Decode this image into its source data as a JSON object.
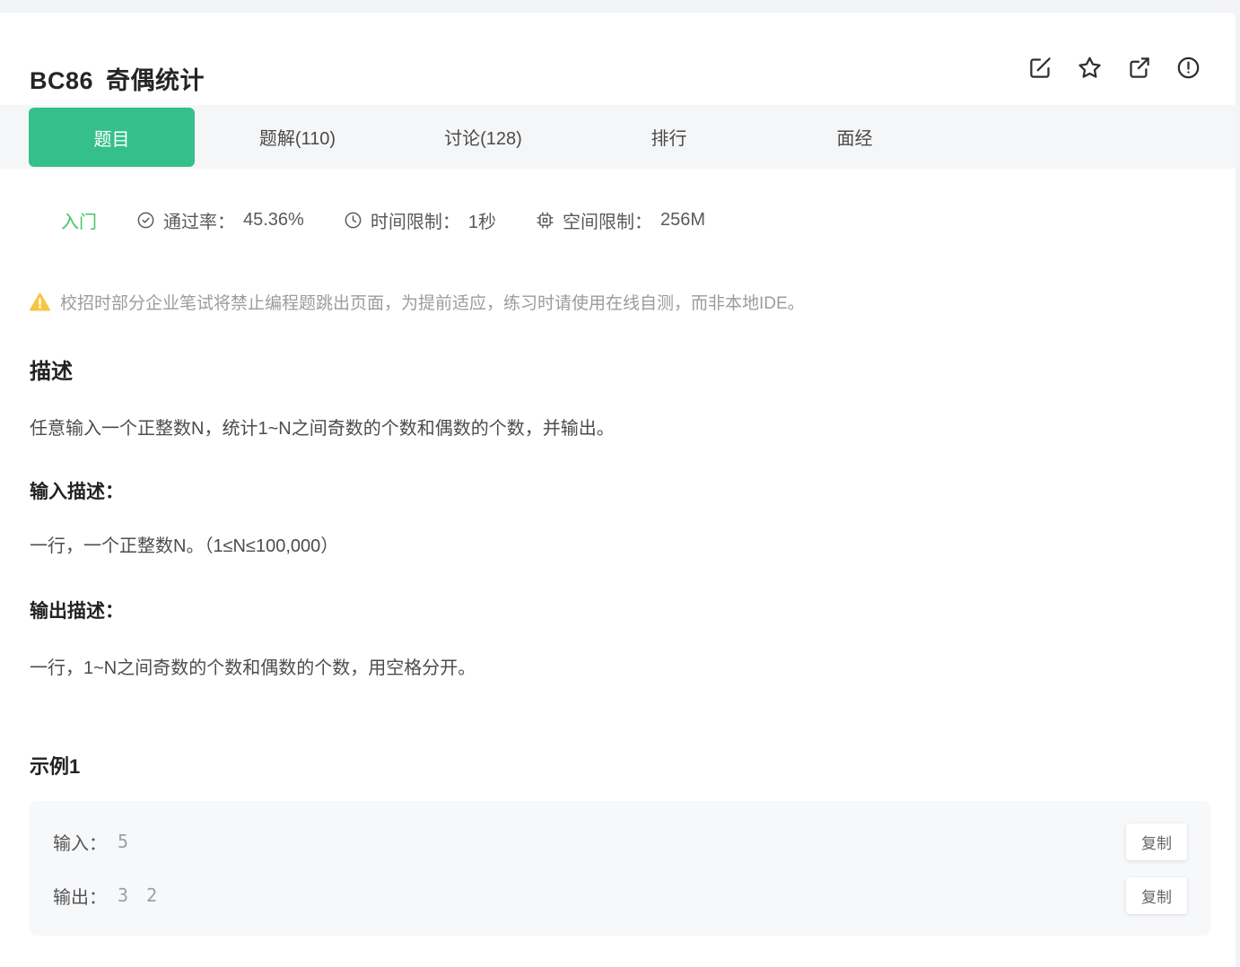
{
  "colors": {
    "accent_green": "#35c08b",
    "difficulty_green": "#45c465",
    "warning_yellow": "#f6c643",
    "tabbar_bg": "#f5f6f7",
    "example_bg": "#f7f8fa"
  },
  "header": {
    "problem_id": "BC86",
    "problem_title": "奇偶统计"
  },
  "tabs": [
    {
      "label": "题目",
      "active": true
    },
    {
      "label": "题解(110)",
      "active": false
    },
    {
      "label": "讨论(128)",
      "active": false
    },
    {
      "label": "排行",
      "active": false
    },
    {
      "label": "面经",
      "active": false
    }
  ],
  "meta": {
    "difficulty": "入门",
    "pass_rate_label": "通过率：",
    "pass_rate_value": "45.36%",
    "time_limit_label": "时间限制：",
    "time_limit_value": "1秒",
    "space_limit_label": "空间限制：",
    "space_limit_value": "256M"
  },
  "notice": {
    "text": "校招时部分企业笔试将禁止编程题跳出页面，为提前适应，练习时请使用在线自测，而非本地IDE。"
  },
  "description": {
    "heading": "描述",
    "body": "任意输入一个正整数N，统计1~N之间奇数的个数和偶数的个数，并输出。"
  },
  "input_description": {
    "heading": "输入描述：",
    "body": "一行，一个正整数N。（1≤N≤100,000）"
  },
  "output_description": {
    "heading": "输出描述：",
    "body": "一行，1~N之间奇数的个数和偶数的个数，用空格分开。"
  },
  "example": {
    "heading": "示例1",
    "rows": [
      {
        "label": "输入：",
        "value": "5",
        "copy_label": "复制"
      },
      {
        "label": "输出：",
        "value": "3 2",
        "copy_label": "复制"
      }
    ]
  }
}
